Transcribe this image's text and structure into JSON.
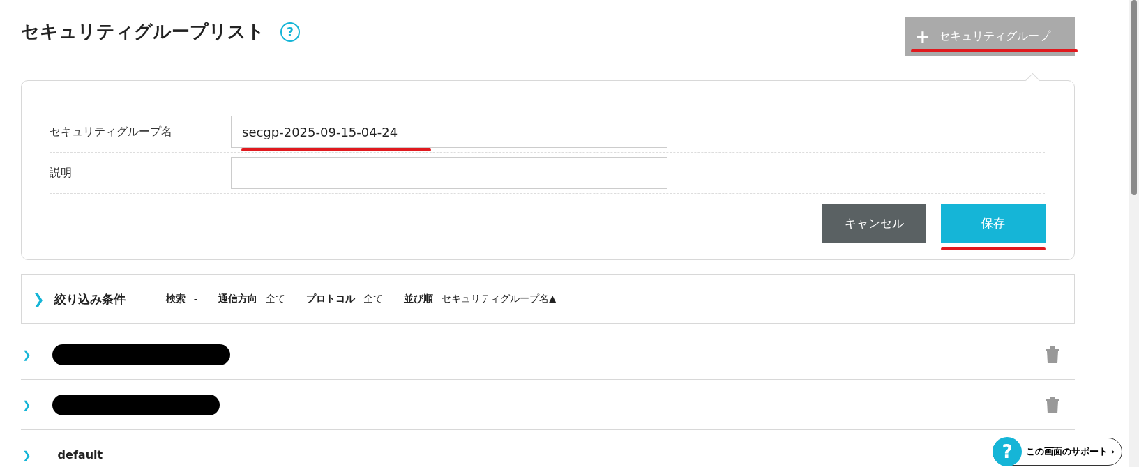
{
  "header": {
    "title": "セキュリティグループリスト",
    "help_icon": "?",
    "add_button": {
      "icon": "+",
      "label": "セキュリティグループ",
      "underlined": true
    }
  },
  "form": {
    "fields": [
      {
        "label": "セキュリティグループ名",
        "value": "secgp-2025-09-15-04-24",
        "underlined": true
      },
      {
        "label": "説明"
      }
    ],
    "buttons": [
      {
        "kind": "cancel",
        "label": "キャンセル",
        "underlined": false
      },
      {
        "kind": "save",
        "label": "保存",
        "underlined": true
      }
    ]
  },
  "filter": {
    "chevron": "❯",
    "title": "絞り込み条件",
    "expanded": false,
    "conditions": [
      {
        "label": "検索",
        "value": "-"
      },
      {
        "label": "通信方向",
        "value": "全て"
      },
      {
        "label": "プロトコル",
        "value": "全て"
      },
      {
        "label": "並び順",
        "value": "セキュリティグループ名▲"
      }
    ]
  },
  "groups": [
    {
      "chevron": "❯",
      "kind": "redacted",
      "deletable": true
    },
    {
      "chevron": "❯",
      "kind": "redacted",
      "deletable": true
    },
    {
      "chevron": "❯",
      "kind": "name",
      "name": "default",
      "deletable": false
    }
  ],
  "support_button": {
    "icon": "?",
    "label": "この画面のサポート",
    "arrow": "›"
  }
}
